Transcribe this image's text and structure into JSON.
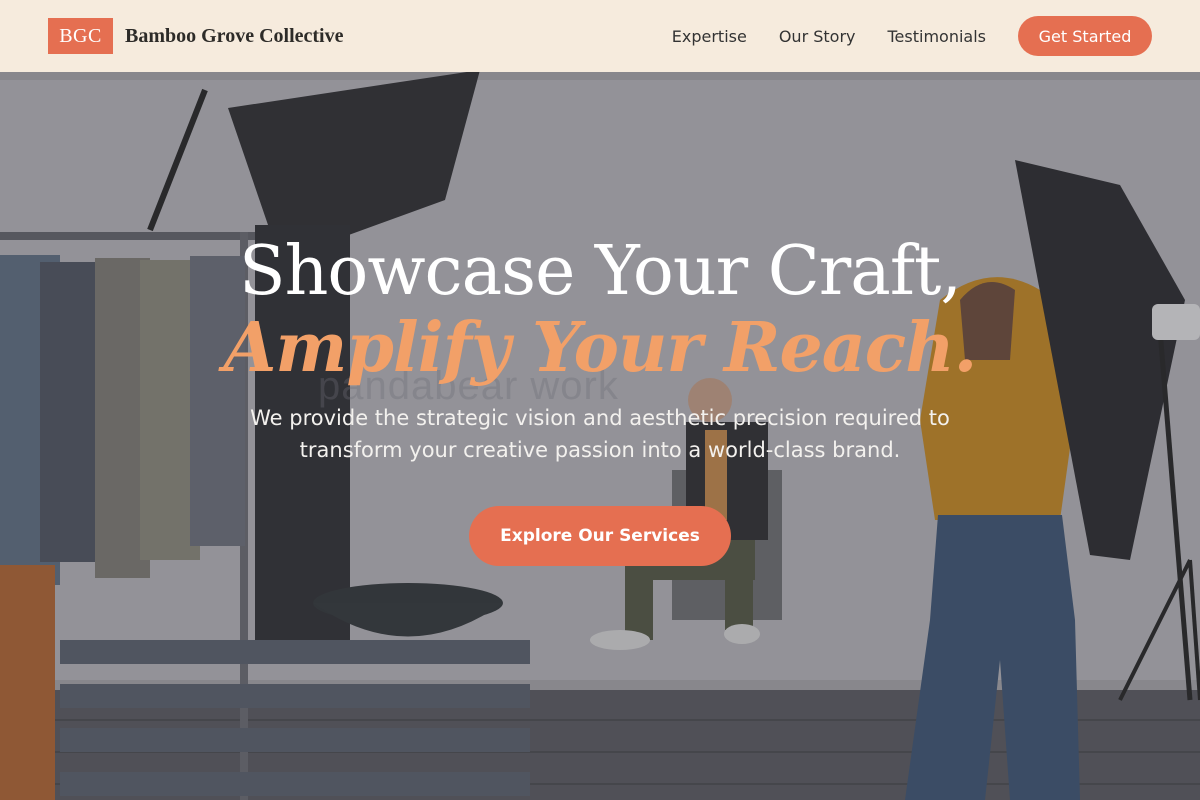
{
  "navbar": {
    "logo_mark": "BGC",
    "brand_name": "Bamboo Grove Collective",
    "links": [
      {
        "label": "Expertise"
      },
      {
        "label": "Our Story"
      },
      {
        "label": "Testimonials"
      }
    ],
    "cta_label": "Get Started"
  },
  "hero": {
    "headline_line1": "Showcase Your Craft,",
    "headline_line2": "Amplify Your Reach.",
    "subtext": "We provide the strategic vision and aesthetic precision required to transform your creative passion into a world-class brand.",
    "cta_label": "Explore Our Services",
    "background_image": "photo-studio-scene",
    "watermark_text": "pandabear work"
  },
  "colors": {
    "accent": "#e56f51",
    "accent_light": "#f2a068",
    "nav_bg": "#fbefe0",
    "text_dark": "#2d2b28"
  }
}
